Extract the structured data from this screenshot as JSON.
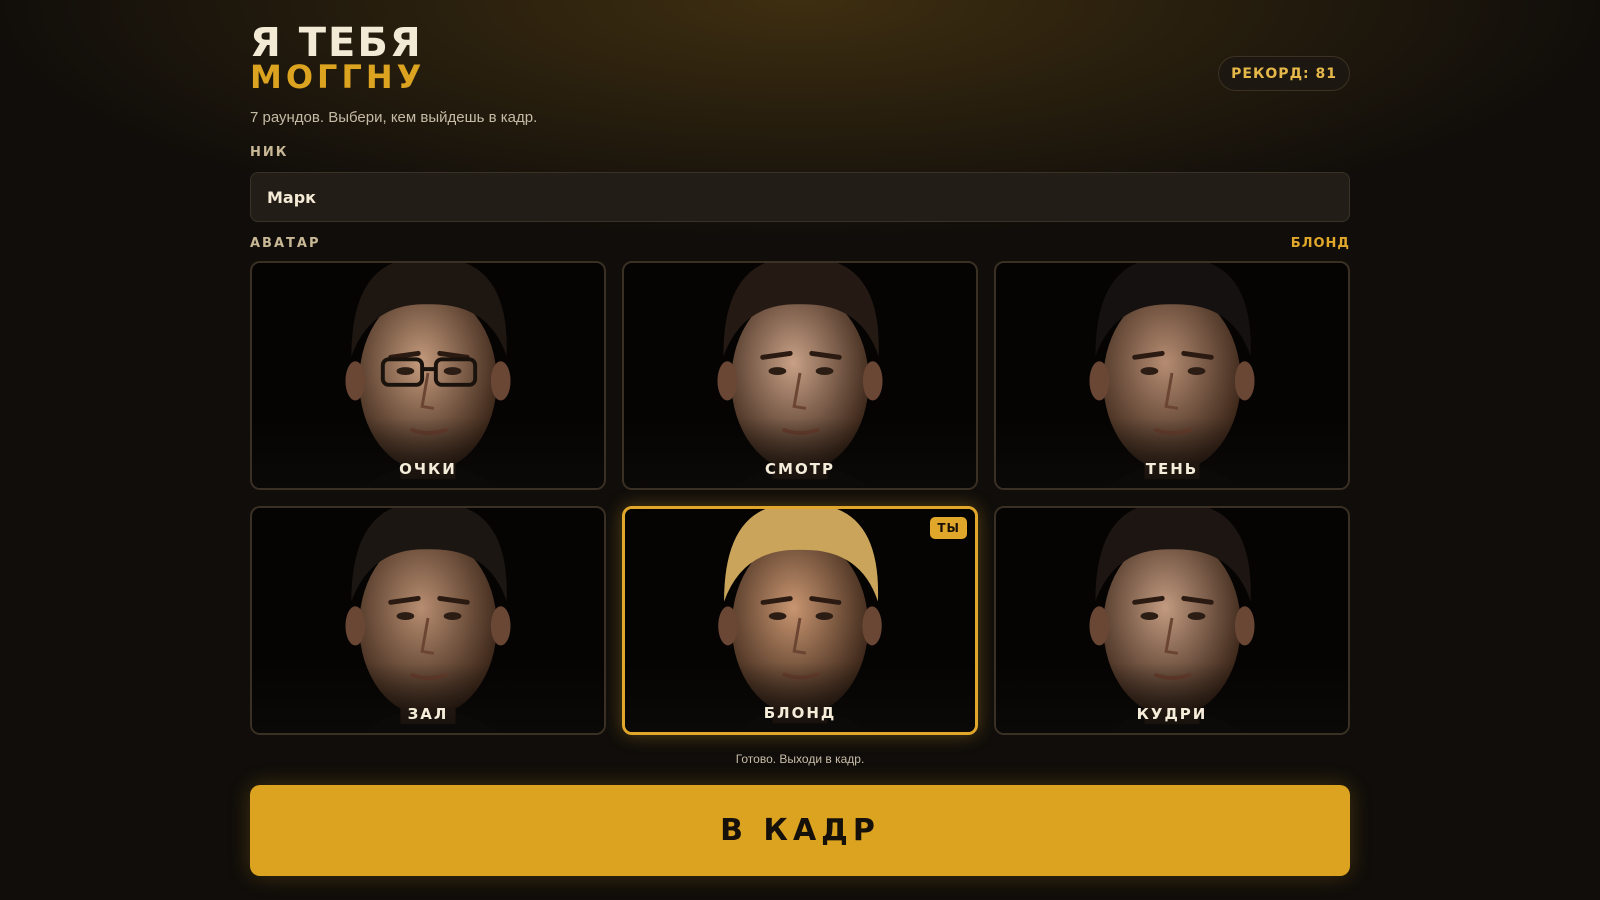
{
  "header": {
    "title_line1": "Я ТЕБЯ",
    "title_line2": "МОГГНУ",
    "record": "РЕКОРД: 81",
    "subtitle": "7 раундов. Выбери, кем выйдешь в кадр."
  },
  "nick": {
    "label": "НИК",
    "value": "Марк"
  },
  "avatar": {
    "label": "АВАТАР",
    "selected_name": "БЛОНД",
    "you_badge": "ТЫ",
    "cards": [
      {
        "label": "ОЧКИ",
        "hair": "#1d1611",
        "skin": "#c49a7c",
        "glasses": true,
        "selected": false
      },
      {
        "label": "СМОТР",
        "hair": "#241a13",
        "skin": "#c8a086",
        "glasses": false,
        "selected": false
      },
      {
        "label": "ТЕНЬ",
        "hair": "#151110",
        "skin": "#b58c72",
        "glasses": false,
        "selected": false
      },
      {
        "label": "ЗАЛ",
        "hair": "#1b1612",
        "skin": "#b78d70",
        "glasses": false,
        "selected": false
      },
      {
        "label": "БЛОНД",
        "hair": "#c9a45a",
        "skin": "#c89570",
        "glasses": false,
        "selected": true
      },
      {
        "label": "КУДРИ",
        "hair": "#1d1511",
        "skin": "#c29a80",
        "glasses": false,
        "selected": false
      }
    ]
  },
  "status": "Готово. Выходи в кадр.",
  "go_button": "В КАДР",
  "colors": {
    "accent": "#dba31f",
    "background": "#100d0a"
  }
}
